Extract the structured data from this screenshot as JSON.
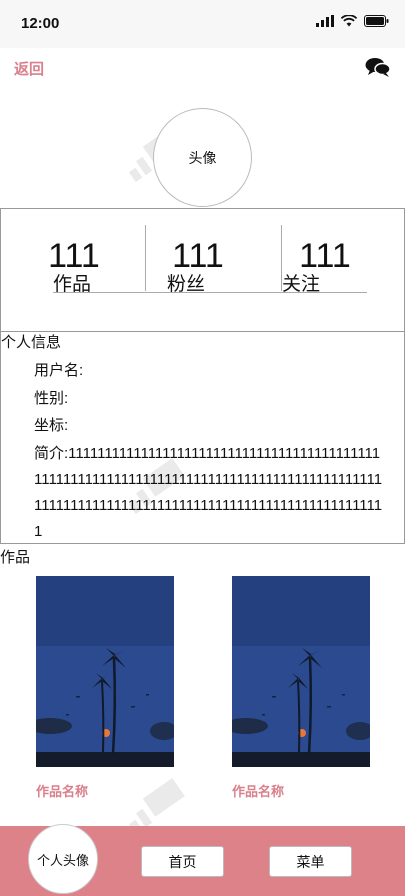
{
  "status_bar": {
    "time": "12:00"
  },
  "nav": {
    "back_label": "返回",
    "chat_icon": "chat-bubbles-icon"
  },
  "profile": {
    "avatar_label": "头像"
  },
  "stats": [
    {
      "count": "111",
      "label": "作品"
    },
    {
      "count": "111",
      "label": "粉丝"
    },
    {
      "count": "111",
      "label": "关注"
    }
  ],
  "info": {
    "title": "个人信息",
    "username_label": "用户名:",
    "gender_label": "性别:",
    "location_label": "坐标:",
    "bio_label": "简介:",
    "bio_text": "11111111111111111111111111111111111111111111111111111111111111111111111111111111111111111111111111111111111111111111111111111111111111111111"
  },
  "works": {
    "title": "作品",
    "items": [
      {
        "name": "作品名称"
      },
      {
        "name": "作品名称"
      }
    ]
  },
  "bottom_bar": {
    "avatar_label": "个人头像",
    "home_label": "首页",
    "menu_label": "菜单"
  },
  "colors": {
    "accent": "#dc8288",
    "link": "#d9808c",
    "photo_sky": "#2b4a8f"
  }
}
